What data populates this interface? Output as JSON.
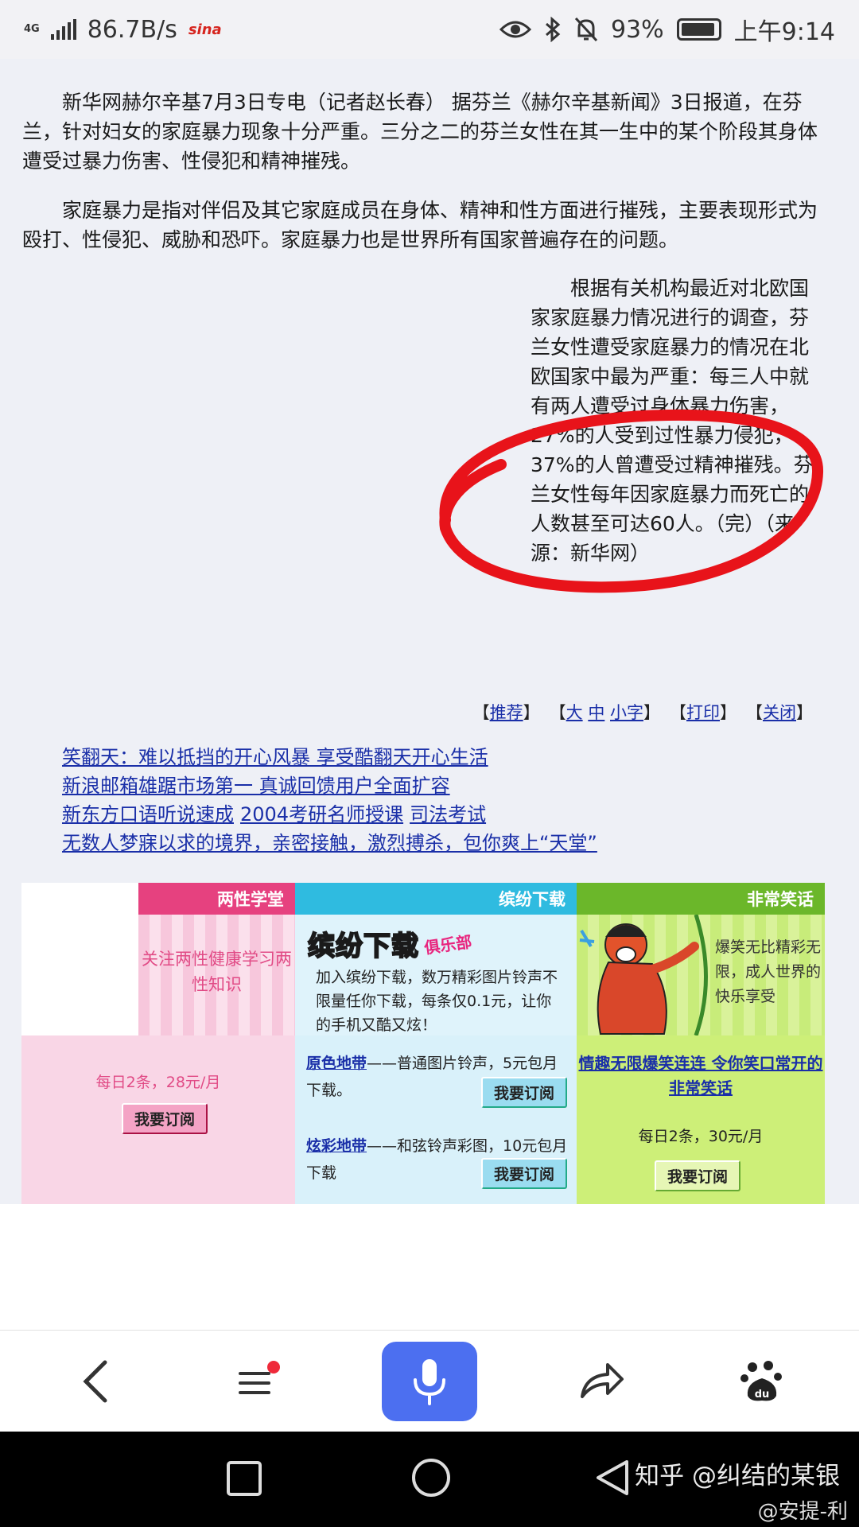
{
  "status": {
    "network": "4G",
    "speed": "86.7B/s",
    "app_badge": "sina",
    "battery": "93%",
    "time": "上午9:14"
  },
  "article": {
    "para1": "新华网赫尔辛基7月3日专电（记者赵长春） 据芬兰《赫尔辛基新闻》3日报道，在芬兰，针对妇女的家庭暴力现象十分严重。三分之二的芬兰女性在其一生中的某个阶段其身体遭受过暴力伤害、性侵犯和精神摧残。",
    "para2": "家庭暴力是指对伴侣及其它家庭成员在身体、精神和性方面进行摧残，主要表现形式为殴打、性侵犯、威胁和恐吓。家庭暴力也是世界所有国家普遍存在的问题。",
    "para3": "根据有关机构最近对北欧国家家庭暴力情况进行的调查，芬兰女性遭受家庭暴力的情况在北欧国家中最为严重：每三人中就有两人遭受过身体暴力伤害，27%的人受到过性暴力侵犯，37%的人曾遭受过精神摧残。芬兰女性每年因家庭暴力而死亡的人数甚至可达60人。（完）（来源：新华网）"
  },
  "toolbar": {
    "recommend": "推荐",
    "large": "大",
    "medium": "中",
    "small": "小字",
    "print": "打印",
    "close": "关闭"
  },
  "ads": [
    [
      "笑翻天：难以抵挡的开心风暴 享受酷翻天开心生活"
    ],
    [
      "新浪邮箱雄踞市场第一 真诚回馈用户全面扩容"
    ],
    [
      "新东方口语听说速成",
      "2004考研名师授课",
      "司法考试"
    ],
    [
      "无数人梦寐以求的境界，亲密接触，激烈搏杀，包你爽上“天堂”"
    ]
  ],
  "promo": {
    "col1_title": "两性学堂",
    "col1_text": "关注两性健康学习两性知识",
    "col1_price": "每日2条，28元/月",
    "col2_title": "缤纷下载",
    "col2_logo": "缤纷下载",
    "col2_logo_sub": "俱乐部",
    "col2_text": "加入缤纷下载，数万精彩图片铃声不限量任你下载，每条仅0.1元，让你的手机又酷又炫！",
    "col2_item1_link": "原色地带",
    "col2_item1_text": "——普通图片铃声，5元包月下载。",
    "col2_item2_link": "炫彩地带",
    "col2_item2_text": "——和弦铃声彩图，10元包月下载",
    "col3_title": "非常笑话",
    "col3_text": "爆笑无比精彩无限，成人世界的快乐享受",
    "col3_headline": "情趣无限爆笑连连 令你笑口常开的非常笑话",
    "col3_price": "每日2条，30元/月",
    "subscribe": "我要订阅"
  },
  "watermark": "知乎 @纠结的某银",
  "watermark2": "@安提-利"
}
